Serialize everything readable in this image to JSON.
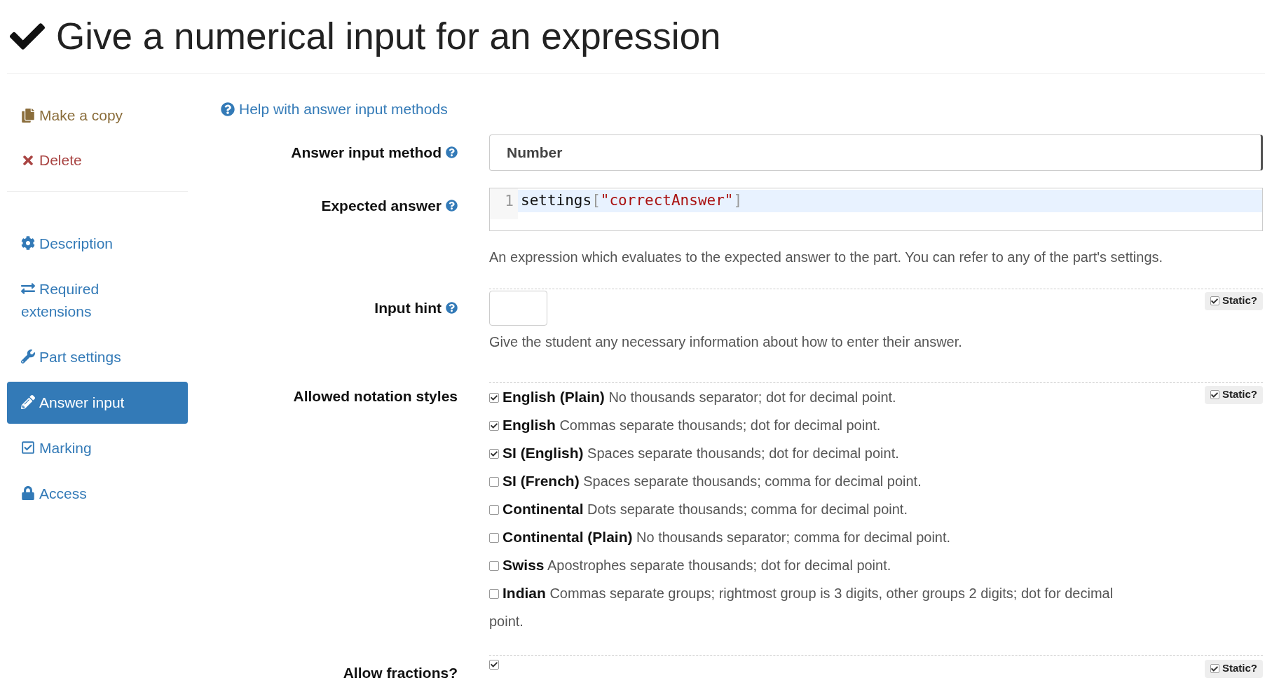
{
  "page": {
    "title": "Give a numerical input for an expression",
    "complete": true
  },
  "sidebar": {
    "actions": [
      {
        "kind": "copy",
        "label": "Make a copy"
      },
      {
        "kind": "delete",
        "label": "Delete"
      }
    ],
    "items": [
      {
        "label": "Description",
        "selected": false
      },
      {
        "label": "Required extensions",
        "selected": false
      },
      {
        "label": "Part settings",
        "selected": false
      },
      {
        "label": "Answer input",
        "selected": true
      },
      {
        "label": "Marking",
        "selected": false
      },
      {
        "label": "Access",
        "selected": false
      }
    ]
  },
  "form": {
    "help_link": "Help with answer input methods",
    "fields": [
      {
        "kind": "select",
        "label": "Answer input method",
        "help": true,
        "value": "Number"
      },
      {
        "kind": "code",
        "label": "Expected answer",
        "help": true,
        "line_number": "1",
        "tokens": [
          {
            "kind": "variable",
            "text": "settings"
          },
          {
            "kind": "bracket",
            "text": "["
          },
          {
            "kind": "string",
            "text": "\"correctAnswer\""
          },
          {
            "kind": "bracket",
            "text": "]"
          }
        ],
        "note": "An expression which evaluates to the expected answer to the part. You can refer to any of the part's settings."
      },
      {
        "kind": "text",
        "label": "Input hint",
        "help": true,
        "static": {
          "label": "Static?",
          "checked": true
        },
        "note": "Give the student any necessary information about how to enter their answer."
      },
      {
        "kind": "checklist",
        "label": "Allowed notation styles",
        "help": false,
        "static": {
          "label": "Static?",
          "checked": true
        },
        "options": [
          {
            "name": "English (Plain)",
            "description": "No thousands separator; dot for decimal point.",
            "checked": true
          },
          {
            "name": "English",
            "description": "Commas separate thousands; dot for decimal point.",
            "checked": true
          },
          {
            "name": "SI (English)",
            "description": "Spaces separate thousands; dot for decimal point.",
            "checked": true
          },
          {
            "name": "SI (French)",
            "description": "Spaces separate thousands; comma for decimal point.",
            "checked": false
          },
          {
            "name": "Continental",
            "description": "Dots separate thousands; comma for decimal point.",
            "checked": false
          },
          {
            "name": "Continental (Plain)",
            "description": "No thousands separator; comma for decimal point.",
            "checked": false
          },
          {
            "name": "Swiss",
            "description": "Apostrophes separate thousands; dot for decimal point.",
            "checked": false
          },
          {
            "name": "Indian",
            "description": "Commas separate groups; rightmost group is 3 digits, other groups 2 digits; dot for decimal point.",
            "checked": false
          }
        ]
      },
      {
        "kind": "checkbox",
        "label": "Allow fractions?",
        "help": false,
        "checked": true,
        "static": {
          "label": "Static?",
          "checked": true
        }
      }
    ]
  }
}
